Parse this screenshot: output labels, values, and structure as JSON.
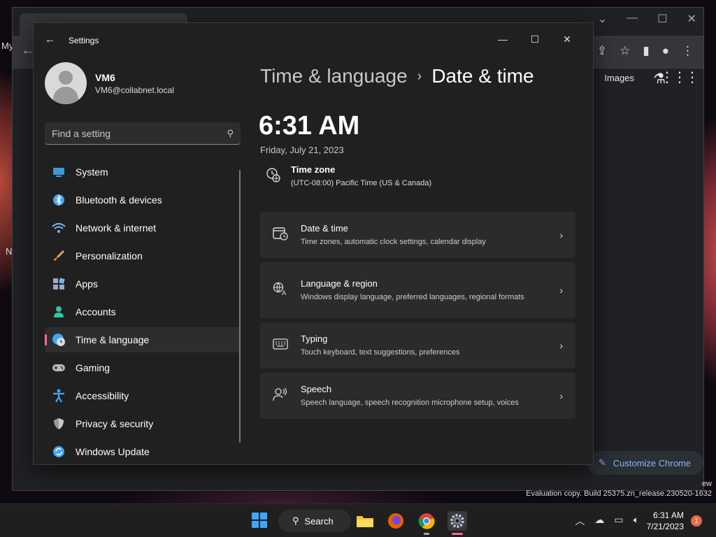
{
  "desktop": {
    "left_labels": [
      "My",
      "N"
    ]
  },
  "chrome": {
    "images_label": "Images",
    "customize_label": "Customize Chrome"
  },
  "settings": {
    "window_title": "Settings",
    "profile": {
      "name": "VM6",
      "email": "VM6@collabnet.local"
    },
    "search_placeholder": "Find a setting",
    "nav": [
      {
        "label": "System",
        "icon": "monitor-icon",
        "color": "#3a9bdc"
      },
      {
        "label": "Bluetooth & devices",
        "icon": "bluetooth-icon",
        "color": "#3fa7f3"
      },
      {
        "label": "Network & internet",
        "icon": "wifi-icon",
        "color": "#6cb8f7"
      },
      {
        "label": "Personalization",
        "icon": "brush-icon",
        "color": "#e0a458"
      },
      {
        "label": "Apps",
        "icon": "apps-icon",
        "color": "#9aa9c7"
      },
      {
        "label": "Accounts",
        "icon": "person-icon",
        "color": "#35c3a3"
      },
      {
        "label": "Time & language",
        "icon": "globe-clock-icon",
        "color": "#3fa7f3",
        "active": true
      },
      {
        "label": "Gaming",
        "icon": "gamepad-icon",
        "color": "#b9b9b9"
      },
      {
        "label": "Accessibility",
        "icon": "accessibility-icon",
        "color": "#3fa7f3"
      },
      {
        "label": "Privacy & security",
        "icon": "shield-icon",
        "color": "#9a9a9a"
      },
      {
        "label": "Windows Update",
        "icon": "update-icon",
        "color": "#3fa7f3"
      }
    ],
    "breadcrumb": {
      "parent": "Time & language",
      "current": "Date & time"
    },
    "time": "6:31 AM",
    "date": "Friday, July 21, 2023",
    "timezone": {
      "title": "Time zone",
      "value": "(UTC-08:00) Pacific Time (US & Canada)"
    },
    "cards": [
      {
        "title": "Date & time",
        "desc": "Time zones, automatic clock settings, calendar display",
        "icon": "calendar-clock-icon"
      },
      {
        "title": "Language & region",
        "desc": "Windows display language, preferred languages, regional formats",
        "icon": "language-icon"
      },
      {
        "title": "Typing",
        "desc": "Touch keyboard, text suggestions, preferences",
        "icon": "keyboard-icon"
      },
      {
        "title": "Speech",
        "desc": "Speech language, speech recognition microphone setup, voices",
        "icon": "speech-icon"
      }
    ]
  },
  "watermark": {
    "edge_text": "ew",
    "build": "Evaluation copy. Build 25375.zn_release.230520-1632"
  },
  "taskbar": {
    "search_label": "Search",
    "clock_time": "6:31 AM",
    "clock_date": "7/21/2023",
    "notification_count": "1"
  }
}
